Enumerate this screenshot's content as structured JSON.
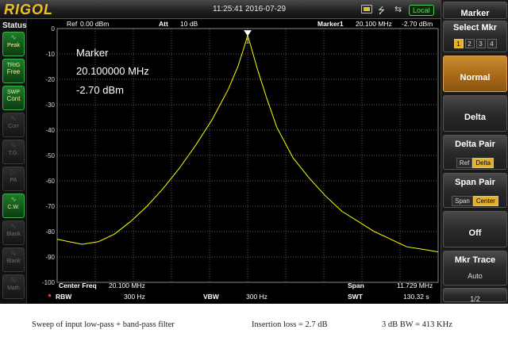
{
  "topbar": {
    "logo": "RIGOL",
    "datetime": "11:25:41  2016-07-29",
    "usb_icon": "usb-icon",
    "lan_icon": "lan-icon",
    "local_label": "Local"
  },
  "status": {
    "title": "Status",
    "buttons": [
      {
        "label1": "Peak",
        "label2": "",
        "icon": "peak-wave-icon",
        "state": "on"
      },
      {
        "label1": "TRIG",
        "label2": "Free",
        "icon": "",
        "state": "on"
      },
      {
        "label1": "SWP",
        "label2": "Cont",
        "icon": "",
        "state": "on"
      },
      {
        "label1": "Corr",
        "label2": "",
        "icon": "corr-icon",
        "state": "off"
      },
      {
        "label1": "T.G.",
        "label2": "",
        "icon": "tg-icon",
        "state": "off"
      },
      {
        "label1": "PA",
        "label2": "",
        "icon": "pa-icon",
        "state": "off"
      },
      {
        "label1": "C.W.",
        "label2": "",
        "icon": "cw-wave-icon",
        "state": "on"
      },
      {
        "label1": "Blank",
        "label2": "",
        "icon": "blank-icon",
        "state": "off"
      },
      {
        "label1": "Blank",
        "label2": "",
        "icon": "blank-icon",
        "state": "off"
      },
      {
        "label1": "Math",
        "label2": "",
        "icon": "math-icon",
        "state": "off"
      }
    ]
  },
  "plot_header": {
    "ref_label": "Ref",
    "ref_value": "0.00 dBm",
    "att_label": "Att",
    "att_value": "10 dB",
    "marker_label": "Marker1",
    "marker_freq": "20.100 MHz",
    "marker_level": "-2.70 dBm"
  },
  "marker_readout": {
    "title": "Marker",
    "freq": "20.100000 MHz",
    "level": "-2.70 dBm",
    "marker_number": "1"
  },
  "footer": {
    "center_label": "Center Freq",
    "center_value": "20.100 MHz",
    "span_label": "Span",
    "span_value": "11.729 MHz",
    "rbw_label": "RBW",
    "rbw_value": "300 Hz",
    "vbw_label": "VBW",
    "vbw_value": "300 Hz",
    "swt_label": "SWT",
    "swt_value": "130.32 s"
  },
  "softkeys": {
    "menu_title": "Marker",
    "select_mkr_title": "Select Mkr",
    "marker_numbers": [
      "1",
      "2",
      "3",
      "4"
    ],
    "selected_marker": "1",
    "normal": "Normal",
    "delta": "Delta",
    "delta_pair_title": "Delta Pair",
    "delta_pair_options": [
      "Ref",
      "Delta"
    ],
    "delta_pair_selected": "Delta",
    "span_pair_title": "Span Pair",
    "span_pair_options": [
      "Span",
      "Center"
    ],
    "span_pair_selected": "Center",
    "off": "Off",
    "mkr_trace_title": "Mkr Trace",
    "mkr_trace_value": "Auto",
    "page": "1/2"
  },
  "caption": {
    "left": "Sweep of input low-pass + band-pass filter",
    "middle": "Insertion loss = 2.7 dB",
    "right": "3 dB BW = 413 KHz"
  },
  "chart_data": {
    "type": "line",
    "ytick_labels": [
      "0",
      "-10",
      "-20",
      "-30",
      "-40",
      "-50",
      "-60",
      "-70",
      "-80",
      "-90",
      "-100"
    ],
    "ylim": [
      -100,
      0
    ],
    "yunit": "dBm",
    "grid": true,
    "trace_color": "#ffff00",
    "series": [
      {
        "x": [
          14.235,
          14.6,
          15.0,
          15.5,
          16.0,
          16.5,
          17.0,
          17.5,
          18.0,
          18.5,
          19.0,
          19.5,
          19.8,
          20.0,
          20.1,
          20.2,
          20.4,
          20.7,
          21.0,
          21.5,
          22.0,
          22.5,
          23.0,
          23.5,
          24.0,
          24.5,
          25.0,
          25.5,
          25.964
        ],
        "y": [
          -83,
          -84,
          -85,
          -84,
          -81,
          -76,
          -70,
          -63,
          -55,
          -46,
          -36,
          -24,
          -15,
          -7,
          -2.7,
          -7,
          -16,
          -28,
          -39,
          -51,
          -59,
          -66,
          -72,
          -76,
          -80,
          -83,
          -86,
          -87,
          -88
        ]
      }
    ]
  }
}
